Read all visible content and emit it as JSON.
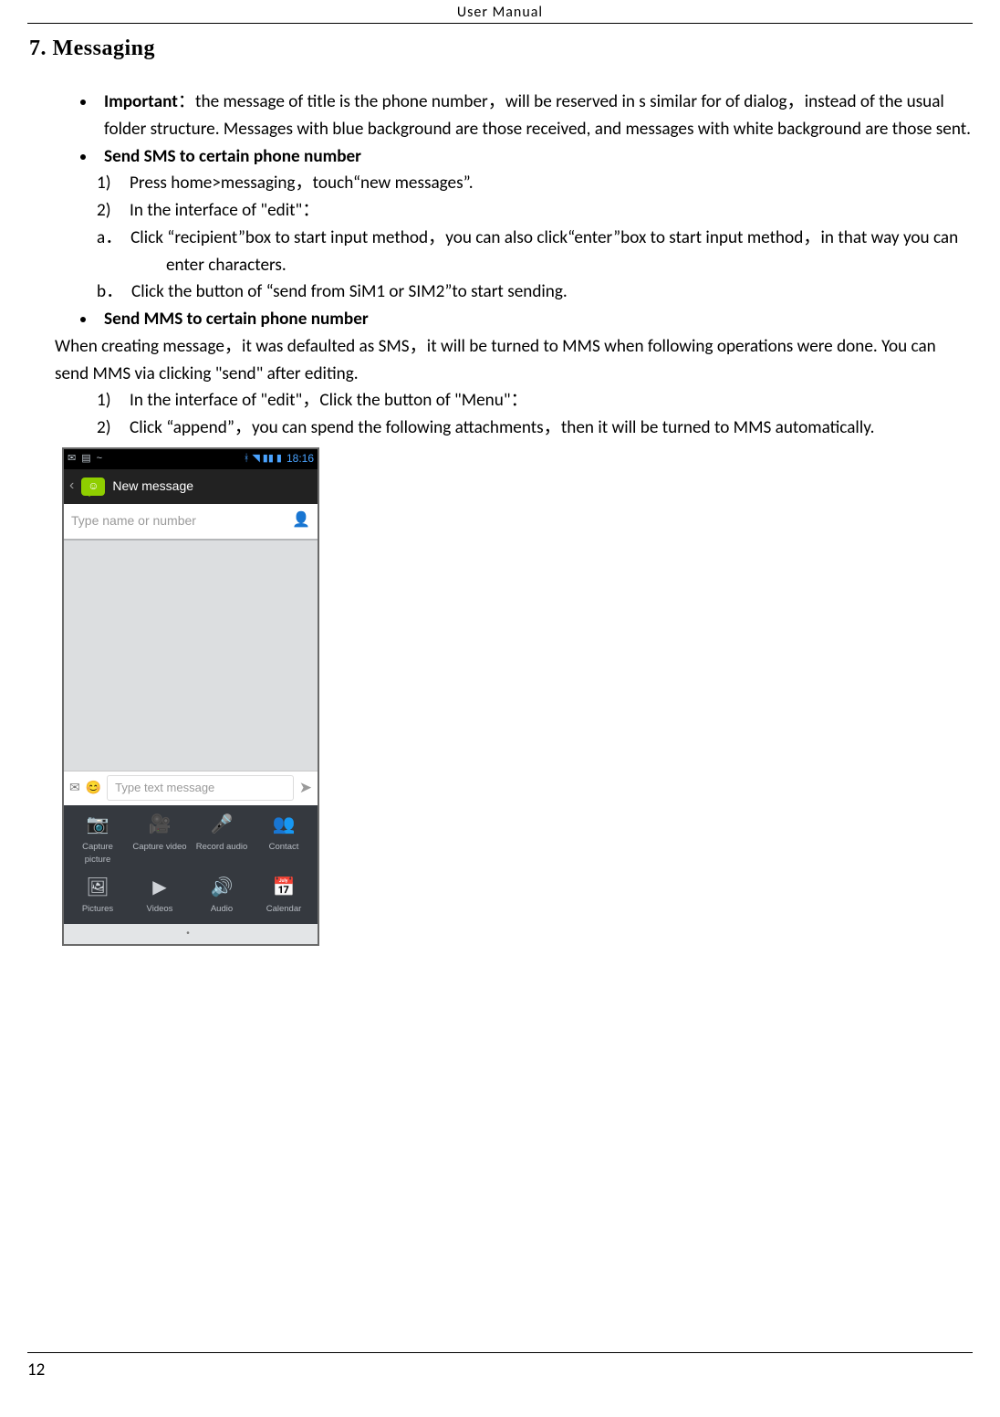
{
  "header": "User    Manual",
  "section_title": "7. Messaging",
  "body": {
    "important_label": "Important",
    "important_text": "：the message of title is the phone number，will be reserved in s similar for of dialog，instead of the usual folder structure. Messages with blue background are those received, and messages with white background are those sent.",
    "send_sms_label": "Send SMS to certain phone number",
    "sms_steps": {
      "s1_num": "1)",
      "s1_text": "Press home>messaging，touch“new messages”.",
      "s2_num": "2)",
      "s2_text": "In the interface of \"edit\"："
    },
    "sms_sub": {
      "a_lbl": "a．",
      "a_text": "Click  “recipient”box to start input method，you can also click“enter”box to start input method，in that way you can enter characters.",
      "b_lbl": "b．",
      "b_text": "Click the button of  “send from SiM1 or SIM2”to start sending."
    },
    "send_mms_label": "Send MMS to certain phone number",
    "mms_intro": "When creating   message，it was defaulted as SMS，it will be turned to MMS when following operations were done. You can send MMS via clicking \"send\" after editing.",
    "mms_steps": {
      "s1_num": "1)",
      "s1_text": "In the interface of \"edit\"，Click the button of \"Menu\"：",
      "s2_num": "2)",
      "s2_text": "Click “append”，you can spend   the following   attachments，then it will be turned to MMS automatically."
    }
  },
  "phone": {
    "statusbar_time": "18:16",
    "appbar_title": "New message",
    "recipient_placeholder": "Type name or number",
    "compose_placeholder": "Type text message",
    "grid_labels": {
      "capture_picture": "Capture picture",
      "capture_video": "Capture video",
      "record_audio": "Record audio",
      "contact": "Contact",
      "pictures": "Pictures",
      "videos": "Videos",
      "audio": "Audio",
      "calendar": "Calendar"
    }
  },
  "page_number": "12"
}
